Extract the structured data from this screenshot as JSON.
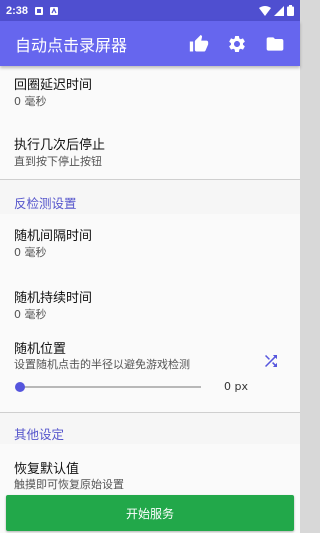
{
  "status_bar": {
    "time": "2:38"
  },
  "app_bar": {
    "title": "自动点击录屏器"
  },
  "settings": {
    "loop_delay": {
      "title": "回圈延迟时间",
      "summary": "0 毫秒"
    },
    "repeat_stop": {
      "title": "执行几次后停止",
      "summary": "直到按下停止按钮"
    },
    "anti_detect_header": "反检测设置",
    "random_interval": {
      "title": "随机间隔时间",
      "summary": "0 毫秒"
    },
    "random_duration": {
      "title": "随机持续时间",
      "summary": "0 毫秒"
    },
    "random_position": {
      "title": "随机位置",
      "summary": "设置随机点击的半径以避免游戏检测",
      "slider_value": 0,
      "value_label": "0 px"
    },
    "other_header": "其他设定",
    "restore_default": {
      "title": "恢复默认值",
      "summary": "触摸即可恢复原始设置"
    }
  },
  "start_button": {
    "label": "开始服务"
  },
  "colors": {
    "status_bar": "#4f4fd0",
    "app_bar": "#6666ee",
    "accent": "#5555cc",
    "start_button": "#22a84a"
  }
}
